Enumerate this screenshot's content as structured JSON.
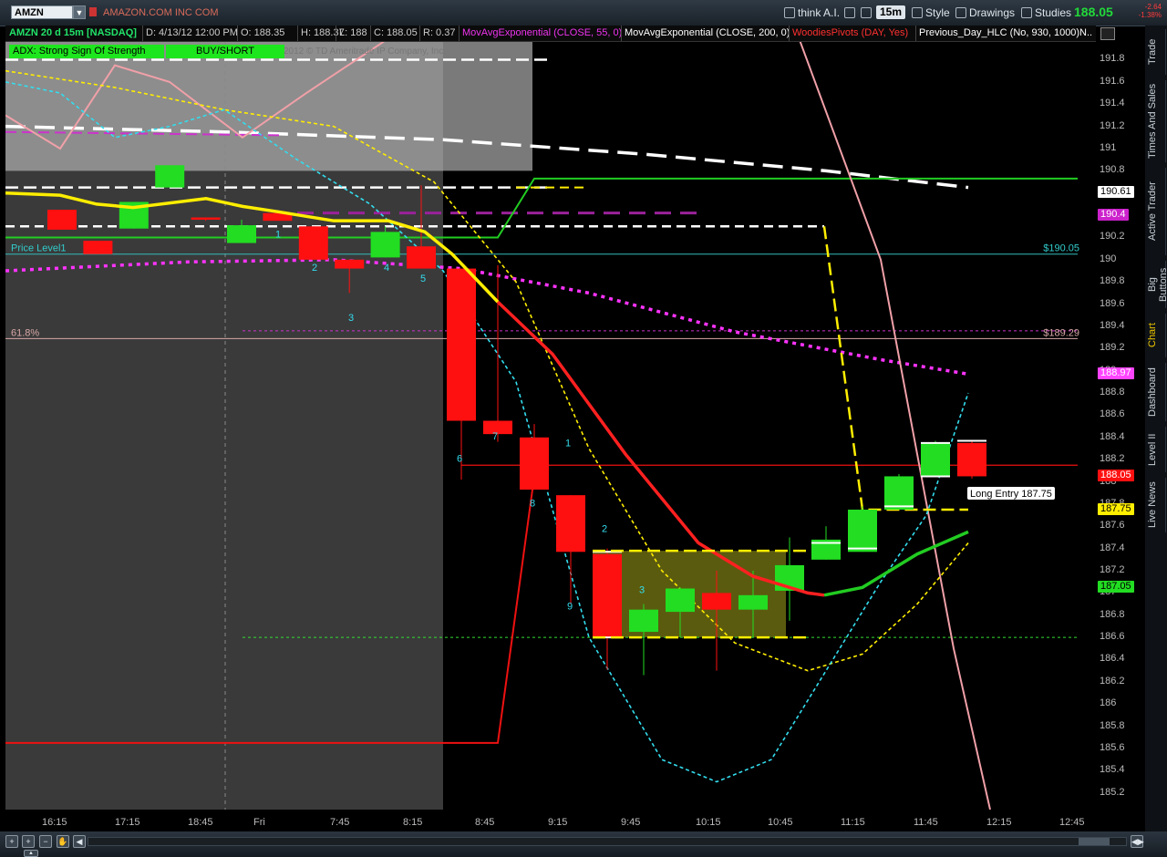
{
  "toolbar": {
    "symbol": "AMZN",
    "company": "AMAZON.COM INC COM",
    "think_ai": "think A.I.",
    "interval": "15m",
    "style": "Style",
    "drawings": "Drawings",
    "studies": "Studies",
    "last_price": "188.05",
    "change_1": "-2.64",
    "change_2": "-1.38%"
  },
  "infobar": {
    "title": "AMZN 20 d 15m [NASDAQ]",
    "date": "D: 4/13/12 12:00 PM",
    "open": "O: 188.35",
    "high": "H: 188.37",
    "low": "L: 188",
    "close": "C: 188.05",
    "range": "R: 0.37",
    "study1": "MovAvgExponential (CLOSE, 55, 0)",
    "study2": "MovAvgExponential (CLOSE, 200, 0)",
    "study3": "WoodiesPivots (DAY, Yes)",
    "study4": "Previous_Day_HLC (No, 930, 1000)",
    "more": "N.."
  },
  "adx": {
    "label": "ADX:  Strong Sign Of Strength",
    "signal": "BUY/SHORT",
    "copyright": "2012 © TD Ameritrade IP Company, Inc."
  },
  "chart_labels": {
    "price_level": "Price Level1",
    "price_level_value": "$190.05",
    "fib": "61.8%",
    "fib_value": "$189.29",
    "long_entry": "Long Entry 187.75"
  },
  "colors": {
    "up": "#22dd22",
    "down": "#ff1010",
    "ema55": "#ff2020",
    "ema200": "#ffffff",
    "yellow": "#ffee00",
    "magenta": "#ff33ff",
    "cyan": "#33ddee"
  },
  "chart_data": {
    "type": "candlestick",
    "ylim": [
      185.05,
      191.96
    ],
    "yticks": [
      "191.8",
      "191.6",
      "191.4",
      "191.2",
      "191",
      "190.8",
      "190.6",
      "190.4",
      "190.2",
      "190",
      "189.8",
      "189.6",
      "189.4",
      "189.2",
      "189",
      "188.8",
      "188.6",
      "188.4",
      "188.2",
      "188",
      "187.8",
      "187.6",
      "187.4",
      "187.2",
      "187",
      "186.8",
      "186.6",
      "186.4",
      "186.2",
      "186",
      "185.8",
      "185.6",
      "185.4",
      "185.2"
    ],
    "xticks": [
      "16:15",
      "17:15",
      "18:45",
      "Fri",
      "7:45",
      "8:15",
      "8:45",
      "9:15",
      "9:45",
      "10:15",
      "10:45",
      "11:15",
      "11:45",
      "12:15",
      "12:45"
    ],
    "candles": [
      {
        "o": 190.45,
        "h": 190.45,
        "l": 190.27,
        "c": 190.27
      },
      {
        "o": 190.17,
        "h": 190.17,
        "l": 190.05,
        "c": 190.05
      },
      {
        "o": 190.28,
        "h": 190.52,
        "l": 190.28,
        "c": 190.52
      },
      {
        "o": 190.65,
        "h": 190.85,
        "l": 190.65,
        "c": 190.85
      },
      {
        "o": 190.38,
        "h": 190.38,
        "l": 190.35,
        "c": 190.36
      },
      {
        "o": 190.15,
        "h": 190.36,
        "l": 190.15,
        "c": 190.31
      },
      {
        "o": 190.42,
        "h": 190.42,
        "l": 190.35,
        "c": 190.35
      },
      {
        "o": 190.3,
        "h": 190.3,
        "l": 190,
        "c": 190
      },
      {
        "o": 190,
        "h": 190,
        "l": 189.7,
        "c": 189.92
      },
      {
        "o": 190.02,
        "h": 190.3,
        "l": 190.02,
        "c": 190.25
      },
      {
        "o": 190.12,
        "h": 190.67,
        "l": 189.92,
        "c": 189.92
      },
      {
        "o": 189.92,
        "h": 189.92,
        "l": 188.02,
        "c": 188.55
      },
      {
        "o": 188.55,
        "h": 189.95,
        "l": 188.36,
        "c": 188.43
      },
      {
        "o": 188.4,
        "h": 188.52,
        "l": 187.93,
        "c": 187.93
      },
      {
        "o": 187.88,
        "h": 187.88,
        "l": 186.9,
        "c": 187.37
      },
      {
        "o": 187.35,
        "h": 187.4,
        "l": 186.31,
        "c": 186.6
      },
      {
        "o": 186.65,
        "h": 186.9,
        "l": 186.26,
        "c": 186.85
      },
      {
        "o": 186.83,
        "h": 187.05,
        "l": 186.6,
        "c": 187.04
      },
      {
        "o": 187,
        "h": 187.2,
        "l": 186.3,
        "c": 186.85
      },
      {
        "o": 186.85,
        "h": 187.2,
        "l": 186.6,
        "c": 186.98
      },
      {
        "o": 187.02,
        "h": 187.5,
        "l": 186.75,
        "c": 187.25
      },
      {
        "o": 187.3,
        "h": 187.6,
        "l": 187.3,
        "c": 187.48
      },
      {
        "o": 187.37,
        "h": 187.78,
        "l": 187.37,
        "c": 187.75
      },
      {
        "o": 187.75,
        "h": 188.07,
        "l": 187.75,
        "c": 188.05
      },
      {
        "o": 188.05,
        "h": 188.37,
        "l": 188.05,
        "c": 188.35
      },
      {
        "o": 188.35,
        "h": 188.37,
        "l": 188.03,
        "c": 188.05
      }
    ],
    "counts": [
      "",
      "1",
      "2",
      "3",
      "4",
      "5",
      "6",
      "7",
      "8",
      "1",
      "9",
      "2",
      "3"
    ],
    "right_tags": [
      {
        "value": "190.61",
        "bg": "#ffffff",
        "fg": "#000000"
      },
      {
        "value": "190.4",
        "bg": "#cc22cc",
        "fg": "#ffffff"
      },
      {
        "value": "188.97",
        "bg": "#ff44ff",
        "fg": "#ffffff"
      },
      {
        "value": "188.05",
        "bg": "#ff1010",
        "fg": "#ffffff"
      },
      {
        "value": "187.75",
        "bg": "#ffee00",
        "fg": "#000000"
      },
      {
        "value": "187.05",
        "bg": "#22dd22",
        "fg": "#000000"
      }
    ]
  },
  "side_tabs": [
    "Trade",
    "Times And Sales",
    "Active Trader",
    "Big Buttons",
    "Chart",
    "Dashboard",
    "Level II",
    "Live News"
  ]
}
